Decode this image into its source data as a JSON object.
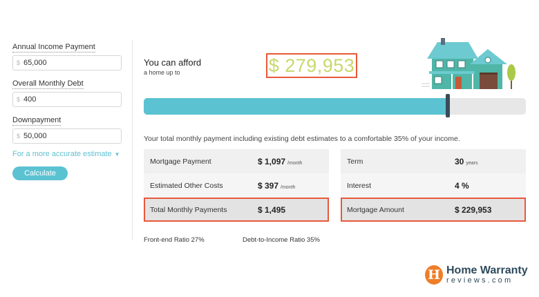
{
  "form": {
    "income_label": "Annual Income Payment",
    "income_currency": "$",
    "income_value": "65,000",
    "debt_label": "Overall Monthly Debt",
    "debt_currency": "$",
    "debt_value": "400",
    "down_label": "Downpayment",
    "down_currency": "$",
    "down_value": "50,000",
    "accurate_link": "For a more accurate estimate",
    "calculate_label": "Calculate"
  },
  "afford": {
    "title": "You can afford",
    "subtitle": "a home up to",
    "price": "$ 279,953"
  },
  "slider": {
    "fraction": 0.796
  },
  "summary": "Your total monthly payment including existing debt estimates to a comfortable 35% of your income.",
  "payments": {
    "mortgage_label": "Mortgage Payment",
    "mortgage_value": "$ 1,097",
    "mortgage_unit": "/month",
    "other_label": "Estimated Other Costs",
    "other_value": "$ 397",
    "other_unit": "/month",
    "total_label": "Total Monthly Payments",
    "total_value": "$ 1,495"
  },
  "loan": {
    "term_label": "Term",
    "term_value": "30",
    "term_unit": "years",
    "interest_label": "Interest",
    "interest_value": "4 %",
    "amount_label": "Mortgage Amount",
    "amount_value": "$ 229,953"
  },
  "ratios": {
    "front_end": "Front-end Ratio 27%",
    "dti": "Debt-to-Income Ratio 35%"
  },
  "logo": {
    "badge": "H",
    "name": "Home Warranty",
    "sub": "reviews.com"
  },
  "colors": {
    "accent": "#5bc2d2",
    "highlight_border": "#e9583a",
    "price_text": "#c9d86b",
    "logo_orange": "#f07d28"
  }
}
